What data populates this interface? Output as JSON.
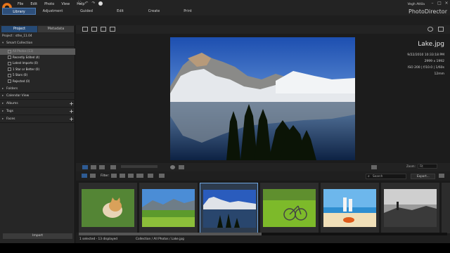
{
  "app": {
    "menu": [
      "File",
      "Edit",
      "Photo",
      "View",
      "Help"
    ],
    "tabs": [
      "Library",
      "Adjustment",
      "Guided",
      "Edit",
      "Create",
      "Print"
    ],
    "user": "Vegh Attila",
    "brand": "PhotoDirector",
    "accent": "#2e4f7a"
  },
  "left_panel": {
    "tabs": [
      "Project",
      "Metadata"
    ],
    "project_line": "Project : sthe_11.04",
    "smart_collection": "Smart Collection",
    "smart_items": [
      "All Photos (13)",
      "Recently Edited (4)",
      "Latest Imports (0)",
      "1 Star or Better (0)",
      "5 Stars (0)",
      "Rejected (0)"
    ],
    "sections": [
      "Folders",
      "Calendar View",
      "Albums",
      "Tags",
      "Faces"
    ],
    "import_label": "Import"
  },
  "viewer": {
    "file_name": "Lake.jpg",
    "date": "9/22/2010 10:33:18 PM",
    "dimensions": "2999 x 1992",
    "exposure": "ISO 200 | f/10.0 | 1/60s",
    "focal": "12mm"
  },
  "filter_bar": {
    "filter_label": "Filter:",
    "search_placeholder": "Search",
    "export_label": "Export...",
    "zoom_label": "Zoom:",
    "zoom_value": "Fit"
  },
  "thumbnails": [
    {
      "name": "cat-photo",
      "selected": false
    },
    {
      "name": "field-photo",
      "selected": false
    },
    {
      "name": "lake-photo",
      "selected": true
    },
    {
      "name": "bicycle-photo",
      "selected": false
    },
    {
      "name": "beach-photo",
      "selected": false
    },
    {
      "name": "mono-photo",
      "selected": false
    }
  ],
  "status": {
    "selection": "1 selected - 13 displayed",
    "path": "Collection / All Photos / Lake.jpg"
  }
}
